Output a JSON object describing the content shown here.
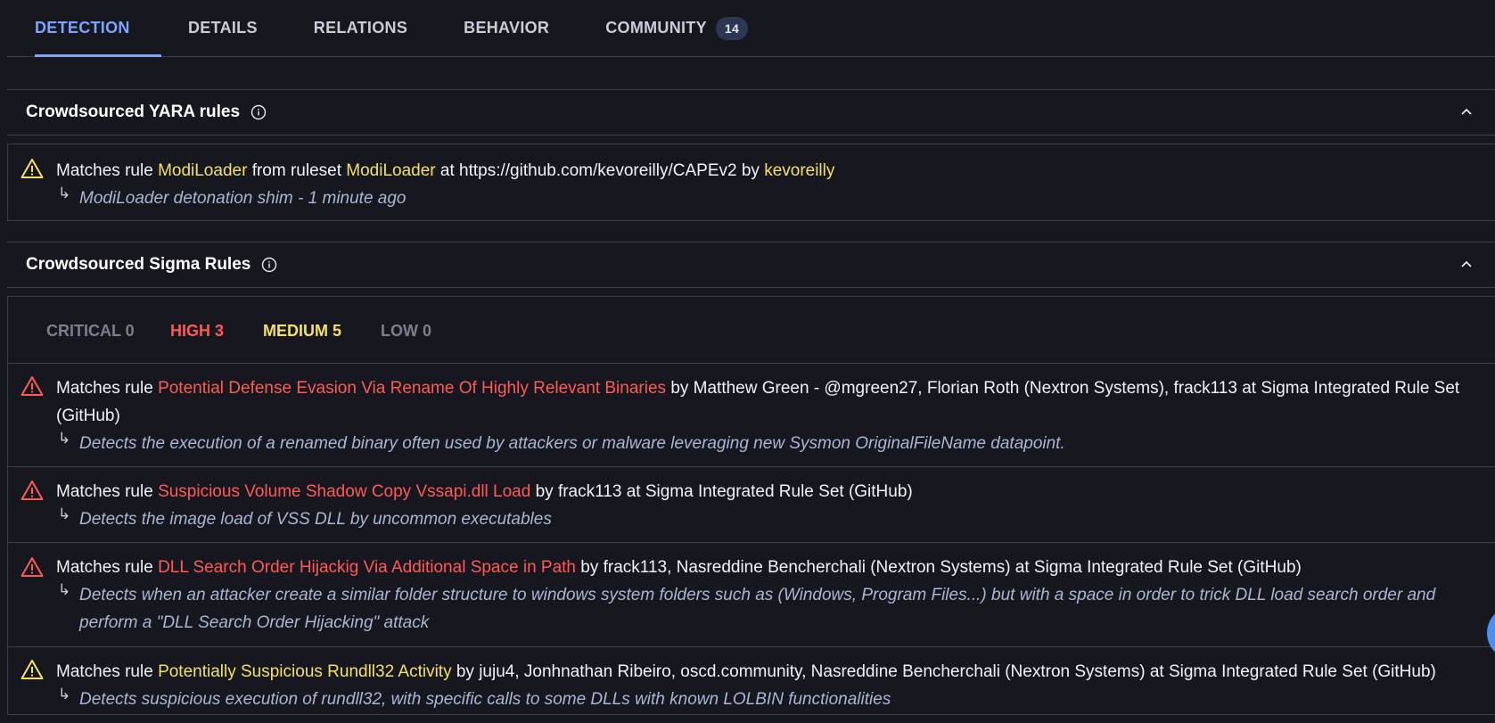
{
  "tabs": {
    "detection": "DETECTION",
    "details": "DETAILS",
    "relations": "RELATIONS",
    "behavior": "BEHAVIOR",
    "community": "COMMUNITY",
    "community_count": "14"
  },
  "yara": {
    "title": "Crowdsourced YARA rules",
    "rule": {
      "prefix": "Matches rule",
      "name": "ModiLoader",
      "from_text": "from ruleset",
      "ruleset": "ModiLoader",
      "at_text": "at https://github.com/kevoreilly/CAPEv2 by",
      "author": "kevoreilly",
      "description": "ModiLoader detonation shim - 1 minute ago"
    }
  },
  "sigma": {
    "title": "Crowdsourced Sigma Rules",
    "severity": {
      "critical": "CRITICAL 0",
      "high": "HIGH 3",
      "medium": "MEDIUM 5",
      "low": "LOW 0"
    },
    "rules": [
      {
        "prefix": "Matches rule",
        "name": "Potential Defense Evasion Via Rename Of Highly Relevant Binaries",
        "by": "by Matthew Green - @mgreen27, Florian Roth (Nextron Systems), frack113 at Sigma Integrated Rule Set",
        "by_cont": "(GitHub)",
        "description": "Detects the execution of a renamed binary often used by attackers or malware leveraging new Sysmon OriginalFileName datapoint."
      },
      {
        "prefix": "Matches rule",
        "name": "Suspicious Volume Shadow Copy Vssapi.dll Load",
        "by": "by frack113 at Sigma Integrated Rule Set (GitHub)",
        "description": "Detects the image load of VSS DLL by uncommon executables"
      },
      {
        "prefix": "Matches rule",
        "name": "DLL Search Order Hijackig Via Additional Space in Path",
        "by": "by frack113, Nasreddine Bencherchali (Nextron Systems) at Sigma Integrated Rule Set (GitHub)",
        "description": "Detects when an attacker create a similar folder structure to windows system folders such as (Windows, Program Files...) but with a space in order to trick DLL load search order and",
        "description_cont": "perform a \"DLL Search Order Hijacking\" attack"
      },
      {
        "prefix": "Matches rule",
        "name": "Potentially Suspicious Rundll32 Activity",
        "by": "by juju4, Jonhnathan Ribeiro, oscd.community, Nasreddine Bencherchali (Nextron Systems) at Sigma Integrated Rule Set (GitHub)",
        "description": "Detects suspicious execution of rundll32, with specific calls to some DLLs with known LOLBIN functionalities"
      }
    ]
  },
  "arrow_glyph": "↳",
  "colors": {
    "accent": "#7ea4ff",
    "high": "#ff5a56",
    "medium": "#f5e067",
    "muted": "#7b7f8e"
  }
}
